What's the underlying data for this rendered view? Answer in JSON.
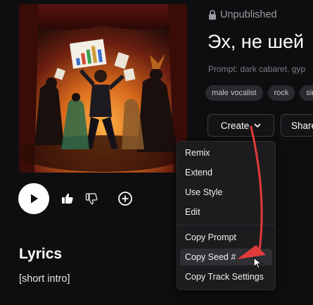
{
  "song": {
    "status": "Unpublished",
    "title": "Эх, не шей",
    "prompt": "Prompt: dark cabaret, gyp",
    "tags": [
      "male vocalist",
      "rock",
      "sing"
    ]
  },
  "actions": {
    "create_label": "Create",
    "share_label": "Share"
  },
  "menu": {
    "items": [
      "Remix",
      "Extend",
      "Use Style",
      "Edit",
      "Copy Prompt",
      "Copy Seed #",
      "Copy Track Settings"
    ],
    "highlighted": "Copy Seed #"
  },
  "lyrics": {
    "heading": "Lyrics",
    "first_line": "[short intro]"
  },
  "colors": {
    "background": "#0e0e10",
    "menu_background": "#1c1c1f",
    "annotation_arrow": "#e03a3a",
    "muted_text": "#9a9aa0"
  },
  "icons": {
    "status": "lock-icon",
    "play": "play-icon",
    "like": "thumbs-up-icon",
    "dislike": "thumbs-down-icon",
    "add": "plus-circle-icon",
    "create_dropdown": "chevron-down-icon"
  }
}
